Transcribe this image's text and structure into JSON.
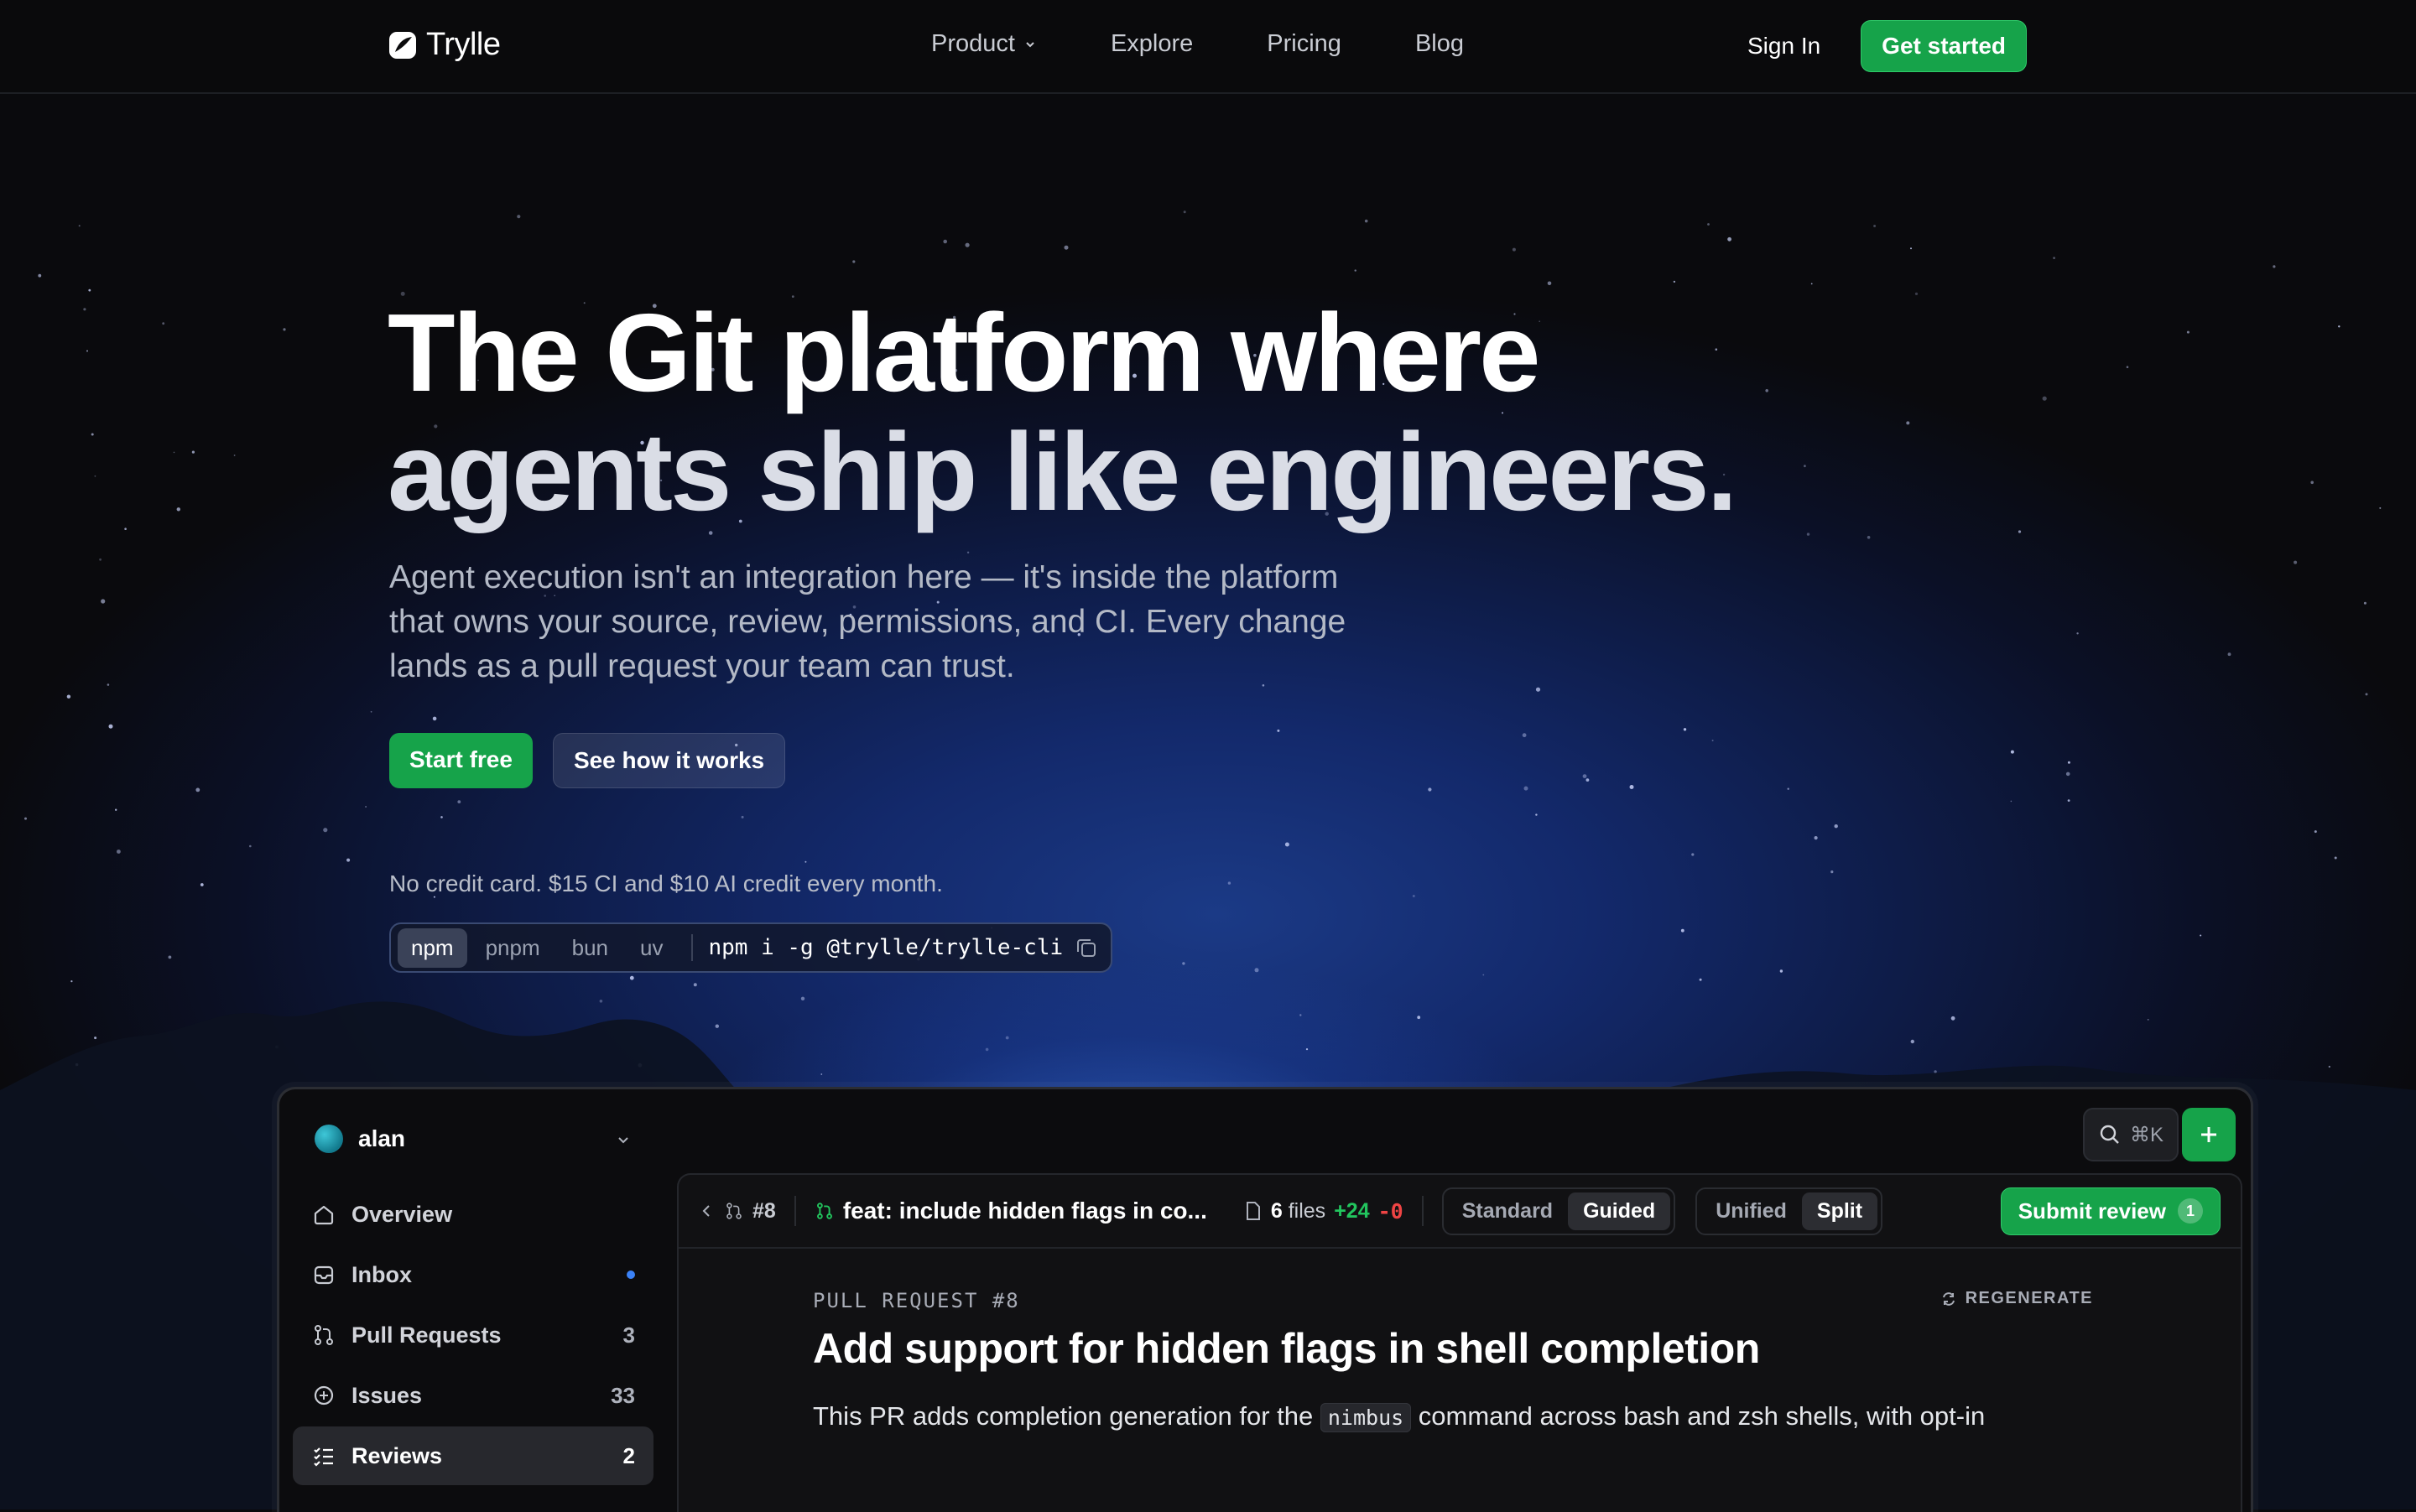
{
  "nav": {
    "brand": "Trylle",
    "links": [
      "Product",
      "Explore",
      "Pricing",
      "Blog"
    ],
    "sign_in": "Sign In",
    "get_started": "Get started"
  },
  "hero": {
    "title_line1": "The Git platform where",
    "title_line2": "agents ship like engineers.",
    "lead": "Agent execution isn't an integration here — it's inside the platform that owns your source, review, permissions, and CI. Every change lands as a pull request your team can trust.",
    "cta_primary": "Start free",
    "cta_secondary": "See how it works",
    "note": "No credit card. $15 CI and $10 AI credit every month."
  },
  "install": {
    "managers": [
      "npm",
      "pnpm",
      "bun",
      "uv"
    ],
    "selected": "npm",
    "command": "npm i -g @trylle/trylle-cli"
  },
  "app": {
    "user": "alan",
    "sidebar": [
      {
        "label": "Overview",
        "count": "",
        "icon": "home-icon"
      },
      {
        "label": "Inbox",
        "count": "",
        "icon": "inbox-icon",
        "unread": true
      },
      {
        "label": "Pull Requests",
        "count": "3",
        "icon": "pull-request-icon"
      },
      {
        "label": "Issues",
        "count": "33",
        "icon": "issue-icon"
      },
      {
        "label": "Reviews",
        "count": "2",
        "icon": "checklist-icon",
        "active": true
      }
    ],
    "search_shortcut": "⌘K",
    "toolbar": {
      "pr_number": "#8",
      "pr_title": "feat: include hidden flags in co...",
      "files_count": "6",
      "files_label": "files",
      "additions": "+24",
      "deletions": "-0",
      "mode_options": [
        "Standard",
        "Guided"
      ],
      "mode_selected": "Guided",
      "view_options": [
        "Unified",
        "Split"
      ],
      "view_selected": "Split",
      "submit": "Submit review",
      "submit_count": "1"
    },
    "content": {
      "kicker": "PULL REQUEST #8",
      "regenerate": "REGENERATE",
      "heading": "Add support for hidden flags in shell completion",
      "para_before": "This PR adds completion generation for the",
      "para_code": "nimbus",
      "para_after": "command across bash and zsh shells, with opt-in"
    }
  },
  "colors": {
    "accent": "#16a34a",
    "background": "#0a0a0d",
    "sky": "#13296b"
  }
}
